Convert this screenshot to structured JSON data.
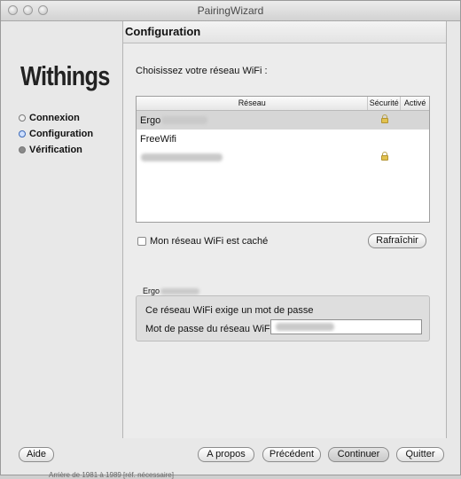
{
  "window": {
    "title": "PairingWizard"
  },
  "sidebar": {
    "logo": "Withings",
    "steps": [
      {
        "label": "Connexion",
        "state": "done"
      },
      {
        "label": "Configuration",
        "state": "current"
      },
      {
        "label": "Vérification",
        "state": "todo"
      }
    ]
  },
  "main": {
    "header": "Configuration",
    "choose_label": "Choisissez votre réseau WiFi :",
    "table": {
      "columns": [
        "Réseau",
        "Sécurité",
        "Activé"
      ],
      "rows": [
        {
          "name": "Ergo",
          "secured": true,
          "selected": true
        },
        {
          "name": "FreeWifi",
          "secured": false,
          "selected": false
        },
        {
          "name": "",
          "secured": true,
          "selected": false
        }
      ]
    },
    "hidden_checkbox_label": "Mon réseau WiFi est caché",
    "refresh_button": "Rafraîchir",
    "group": {
      "title": "Ergo",
      "message": "Ce réseau WiFi exige un mot de passe",
      "password_label": "Mot de passe du réseau WiFi :"
    }
  },
  "buttons": {
    "help": "Aide",
    "about": "A propos",
    "previous": "Précédent",
    "continue": "Continuer",
    "quit": "Quitter"
  },
  "footnote": "Arrière de 1981 à 1989  [réf. nécessaire]",
  "colors": {
    "selected_row": "#d6d6d6",
    "current_step": "#3a68b8",
    "lock": "#e2c24f"
  }
}
